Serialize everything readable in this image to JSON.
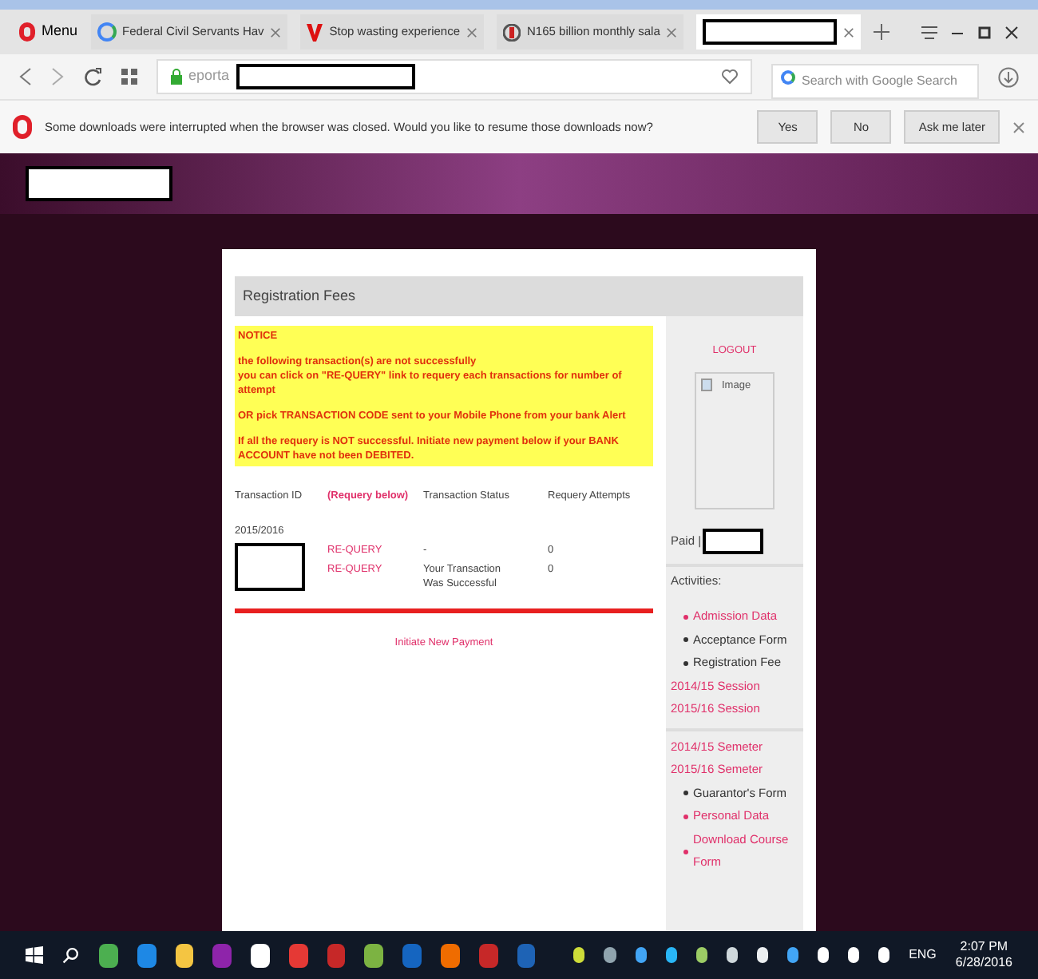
{
  "browser": {
    "menu": "Menu",
    "tabs": [
      {
        "title": "Federal Civil Servants Hav",
        "selected": false
      },
      {
        "title": "Stop wasting experience",
        "selected": false
      },
      {
        "title": "N165 billion monthly sala",
        "selected": false
      },
      {
        "selected": true
      }
    ],
    "address": "eporta",
    "search_placeholder": "Search with Google Search"
  },
  "download_bar": {
    "message": "Some downloads were interrupted when the browser was closed. Would you like to resume those downloads now?",
    "buttons": [
      "Yes",
      "No",
      "Ask me later"
    ]
  },
  "page": {
    "heading": "Registration Fees",
    "notice": {
      "title": "NOTICE",
      "lines": [
        "the following transaction(s) are not successfully",
        "you can click on \"RE-QUERY\" link to requery each transactions for number of attempt"
      ],
      "paragraphs": [
        "OR pick TRANSACTION CODE sent to your Mobile Phone from your bank Alert",
        "If all the requery is NOT successful. Initiate new payment below if your BANK ACCOUNT have not been DEBITED."
      ]
    },
    "table": {
      "columns": [
        "Transaction ID",
        "(Requery below)",
        "Transaction Status",
        "Requery Attempts"
      ],
      "session": "2015/2016",
      "rows": [
        {
          "action": "RE-QUERY",
          "status": "-",
          "attempts": "0"
        },
        {
          "action": "RE-QUERY",
          "status": "Your Transaction Was Successful",
          "attempts": "0"
        }
      ]
    },
    "initiate_link": "Initiate New Payment"
  },
  "sidebar": {
    "logout": "LOGOUT",
    "image_alt": "Image",
    "paid_label": "Paid |",
    "activities_title": "Activities:",
    "sections": [
      [
        {
          "label": "Admission Data",
          "kind": "bullet-link"
        },
        {
          "label": "Acceptance Form",
          "kind": "bullet-text"
        },
        {
          "label": "Registration Fee",
          "kind": "bullet-text"
        },
        {
          "label": "2014/15 Session",
          "kind": "link"
        },
        {
          "label": "2015/16 Session",
          "kind": "link"
        }
      ],
      [
        {
          "label": "2014/15 Semeter",
          "kind": "link"
        },
        {
          "label": "2015/16 Semeter",
          "kind": "link"
        },
        {
          "label": "Guarantor's Form",
          "kind": "bullet-text"
        },
        {
          "label": "Personal Data",
          "kind": "bullet-link"
        },
        {
          "label": "Download Course Form",
          "kind": "bullet-link"
        }
      ]
    ]
  },
  "taskbar": {
    "language": "ENG",
    "time": "2:07 PM",
    "date": "6/28/2016"
  }
}
